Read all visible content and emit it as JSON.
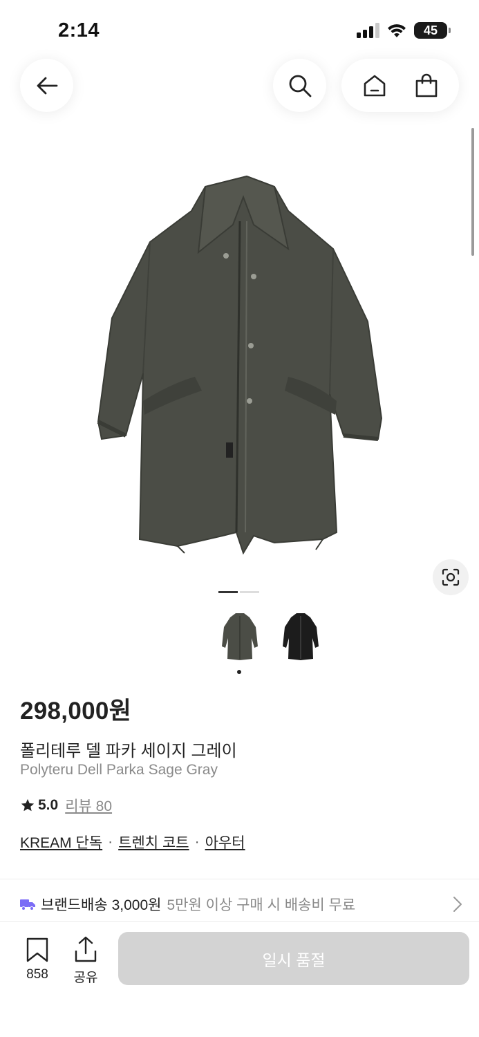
{
  "status_bar": {
    "time": "2:14",
    "battery": "45"
  },
  "header": {
    "icons": [
      "back-arrow-icon",
      "search-icon",
      "home-icon",
      "shopping-bag-icon"
    ]
  },
  "product": {
    "price": "298,000원",
    "name_ko": "폴리테루 델 파카 세이지 그레이",
    "name_en": "Polyteru Dell Parka Sage Gray",
    "rating": "5.0",
    "review_label": "리뷰 80",
    "tags": [
      "KREAM 단독",
      "트렌치 코트",
      "아우터"
    ],
    "tag_separator": "·",
    "image_count": 2,
    "current_image": 1,
    "thumbnail_colors": [
      "#4b4d46",
      "#1c1c1c"
    ]
  },
  "shipping": {
    "title": "브랜드배송",
    "price": "3,000원",
    "description": "5만원 이상 구매 시 배송비 무료",
    "accent_color": "#7b6cf6"
  },
  "bottom_bar": {
    "save_count": "858",
    "share_label": "공유",
    "soldout_label": "일시 품절"
  }
}
